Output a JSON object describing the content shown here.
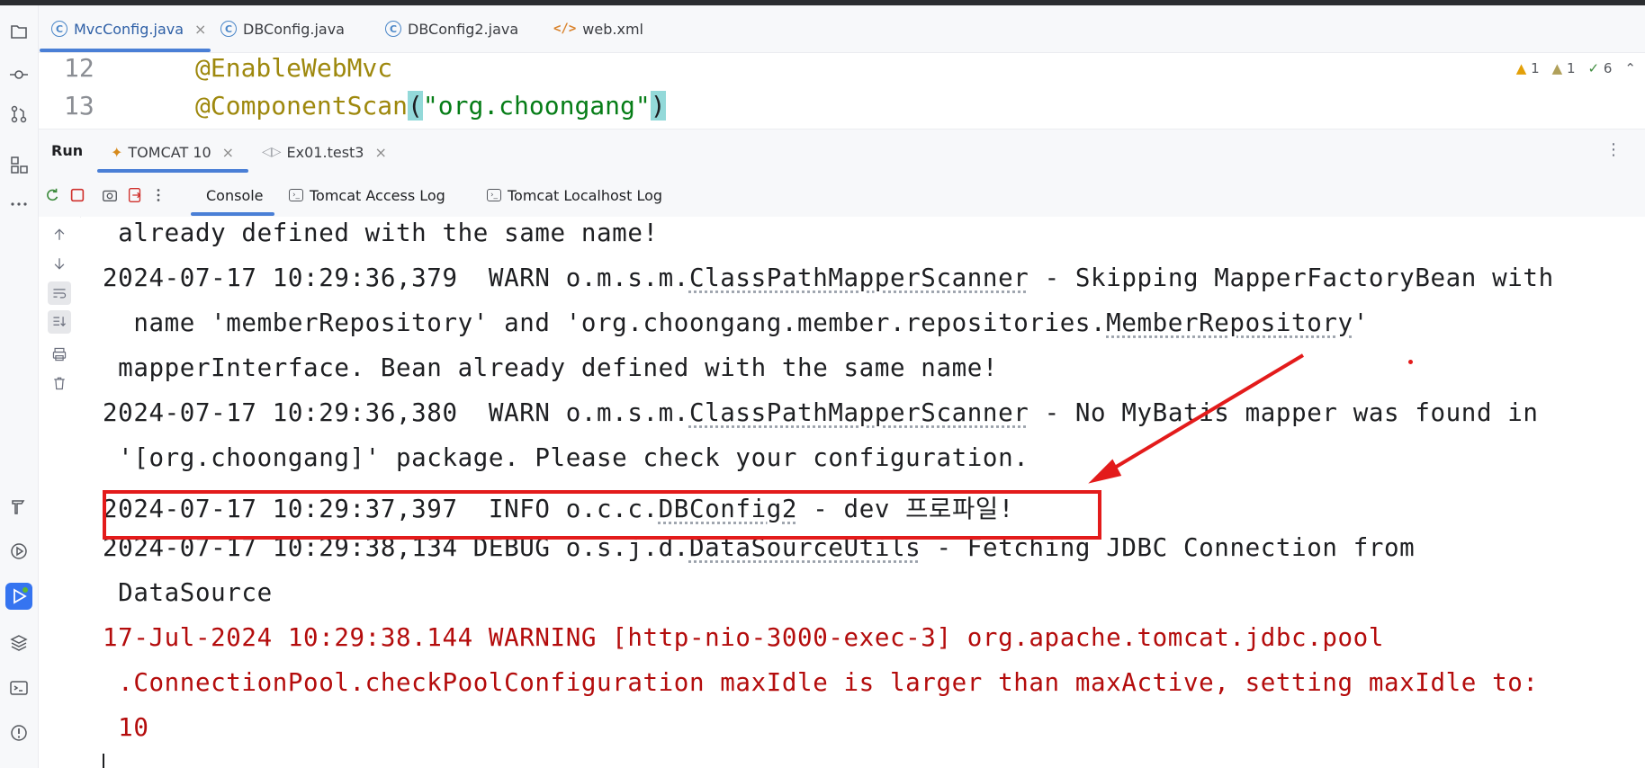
{
  "editor_tabs": [
    {
      "label": "MvcConfig.java",
      "icon": "class-icon",
      "closable": true
    },
    {
      "label": "DBConfig.java",
      "icon": "class-icon"
    },
    {
      "label": "DBConfig2.java",
      "icon": "class-icon"
    },
    {
      "label": "web.xml",
      "icon": "xml-icon"
    }
  ],
  "code": {
    "lines": [
      {
        "number": "12",
        "annotation": "@EnableWebMvc"
      },
      {
        "number": "13",
        "annotation": "@ComponentScan",
        "open_paren": "(",
        "string": "\"org.choongang\"",
        "close_paren": ")"
      }
    ],
    "inspections": {
      "warnings": "1",
      "weak_warnings": "1",
      "typos": "6"
    }
  },
  "run_panel": {
    "title": "Run",
    "tabs": [
      {
        "label": "TOMCAT 10"
      },
      {
        "label": "Ex01.test3"
      }
    ]
  },
  "console_tabs": [
    {
      "label": "Console"
    },
    {
      "label": "Tomcat Access Log"
    },
    {
      "label": "Tomcat Localhost Log"
    }
  ],
  "console_lines": {
    "l1": " already defined with the same name!",
    "l2a": "2024-07-17 10:29:36,379  WARN o.m.s.m.",
    "l2b": "ClassPathMapperScanner",
    "l2c": " - Skipping MapperFactoryBean with",
    "l3a": "  name 'memberRepository' and 'org.choongang.member.repositories.",
    "l3b": "MemberRepository",
    "l3c": "'",
    "l4": " mapperInterface. Bean already defined with the same name!",
    "l5a": "2024-07-17 10:29:36,380  WARN o.m.s.m.",
    "l5b": "ClassPathMapperScanner",
    "l5c": " - No MyBatis mapper was found in",
    "l6": " '[org.choongang]' package. Please check your configuration.",
    "l7a": "2024-07-17 10:29:37,397  INFO o.c.c.",
    "l7b": "DBConfig2",
    "l7c": " - dev 프로파일!",
    "l8a": "2024-07-17 10:29:38,134 DEBUG o.s.j.d.",
    "l8b": "DataSourceUtils",
    "l8c": " - Fetching JDBC Connection from",
    "l9": " DataSource",
    "l10": "17-Jul-2024 10:29:38.144 WARNING [http-nio-3000-exec-3] org.apache.tomcat.jdbc.pool",
    "l11": " .ConnectionPool.checkPoolConfiguration maxIdle is larger than maxActive, setting maxIdle to:",
    "l12": " 10"
  },
  "colors": {
    "highlight_box": "#e31b1b",
    "error_text": "#b40c0c",
    "accent": "#3574f0"
  }
}
